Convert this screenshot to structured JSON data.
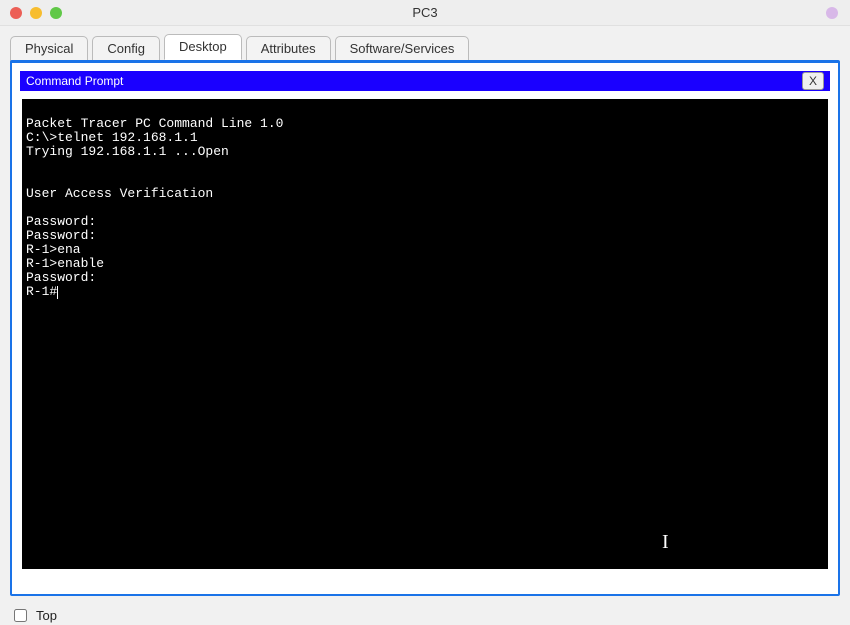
{
  "window": {
    "title": "PC3"
  },
  "tabs": [
    {
      "label": "Physical",
      "active": false
    },
    {
      "label": "Config",
      "active": false
    },
    {
      "label": "Desktop",
      "active": true
    },
    {
      "label": "Attributes",
      "active": false
    },
    {
      "label": "Software/Services",
      "active": false
    }
  ],
  "command_prompt": {
    "title": "Command Prompt",
    "close_label": "X",
    "lines": [
      "Packet Tracer PC Command Line 1.0",
      "C:\\>telnet 192.168.1.1",
      "Trying 192.168.1.1 ...Open",
      "",
      "",
      "User Access Verification",
      "",
      "Password: ",
      "Password: ",
      "R-1>ena",
      "R-1>enable",
      "Password: ",
      "R-1#"
    ]
  },
  "footer": {
    "top_label": "Top",
    "top_checked": false
  }
}
